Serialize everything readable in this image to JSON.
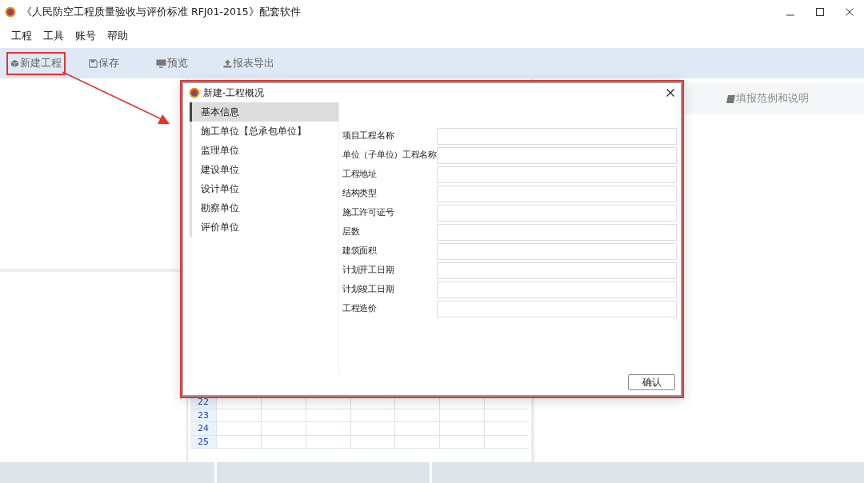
{
  "window": {
    "title": "《人民防空工程质量验收与评价标准 RFJ01-2015》配套软件"
  },
  "menu": [
    "工程",
    "工具",
    "账号",
    "帮助"
  ],
  "toolbar": [
    {
      "label": "新建工程",
      "highlighted": true
    },
    {
      "label": "保存",
      "highlighted": false
    },
    {
      "label": "预览",
      "highlighted": false
    },
    {
      "label": "报表导出",
      "highlighted": false
    }
  ],
  "help_panel": {
    "title": "填报范例和说明"
  },
  "grid": {
    "rows": [
      "22",
      "23",
      "24",
      "25"
    ]
  },
  "dialog": {
    "title": "新建-工程概况",
    "sections": [
      {
        "label": "基本信息",
        "selected": true
      },
      {
        "label": "施工单位【总承包单位】",
        "selected": false
      },
      {
        "label": "监理单位",
        "selected": false
      },
      {
        "label": "建设单位",
        "selected": false
      },
      {
        "label": "设计单位",
        "selected": false
      },
      {
        "label": "勘察单位",
        "selected": false
      },
      {
        "label": "评价单位",
        "selected": false
      }
    ],
    "fields": [
      {
        "label": "项目工程名称"
      },
      {
        "label": "单位（子单位）工程名称"
      },
      {
        "label": "工程地址"
      },
      {
        "label": "结构类型"
      },
      {
        "label": "施工许可证号"
      },
      {
        "label": "层数"
      },
      {
        "label": "建筑面积"
      },
      {
        "label": "计划开工日期"
      },
      {
        "label": "计划竣工日期"
      },
      {
        "label": "工程造价"
      }
    ],
    "confirm_button": "确认"
  }
}
